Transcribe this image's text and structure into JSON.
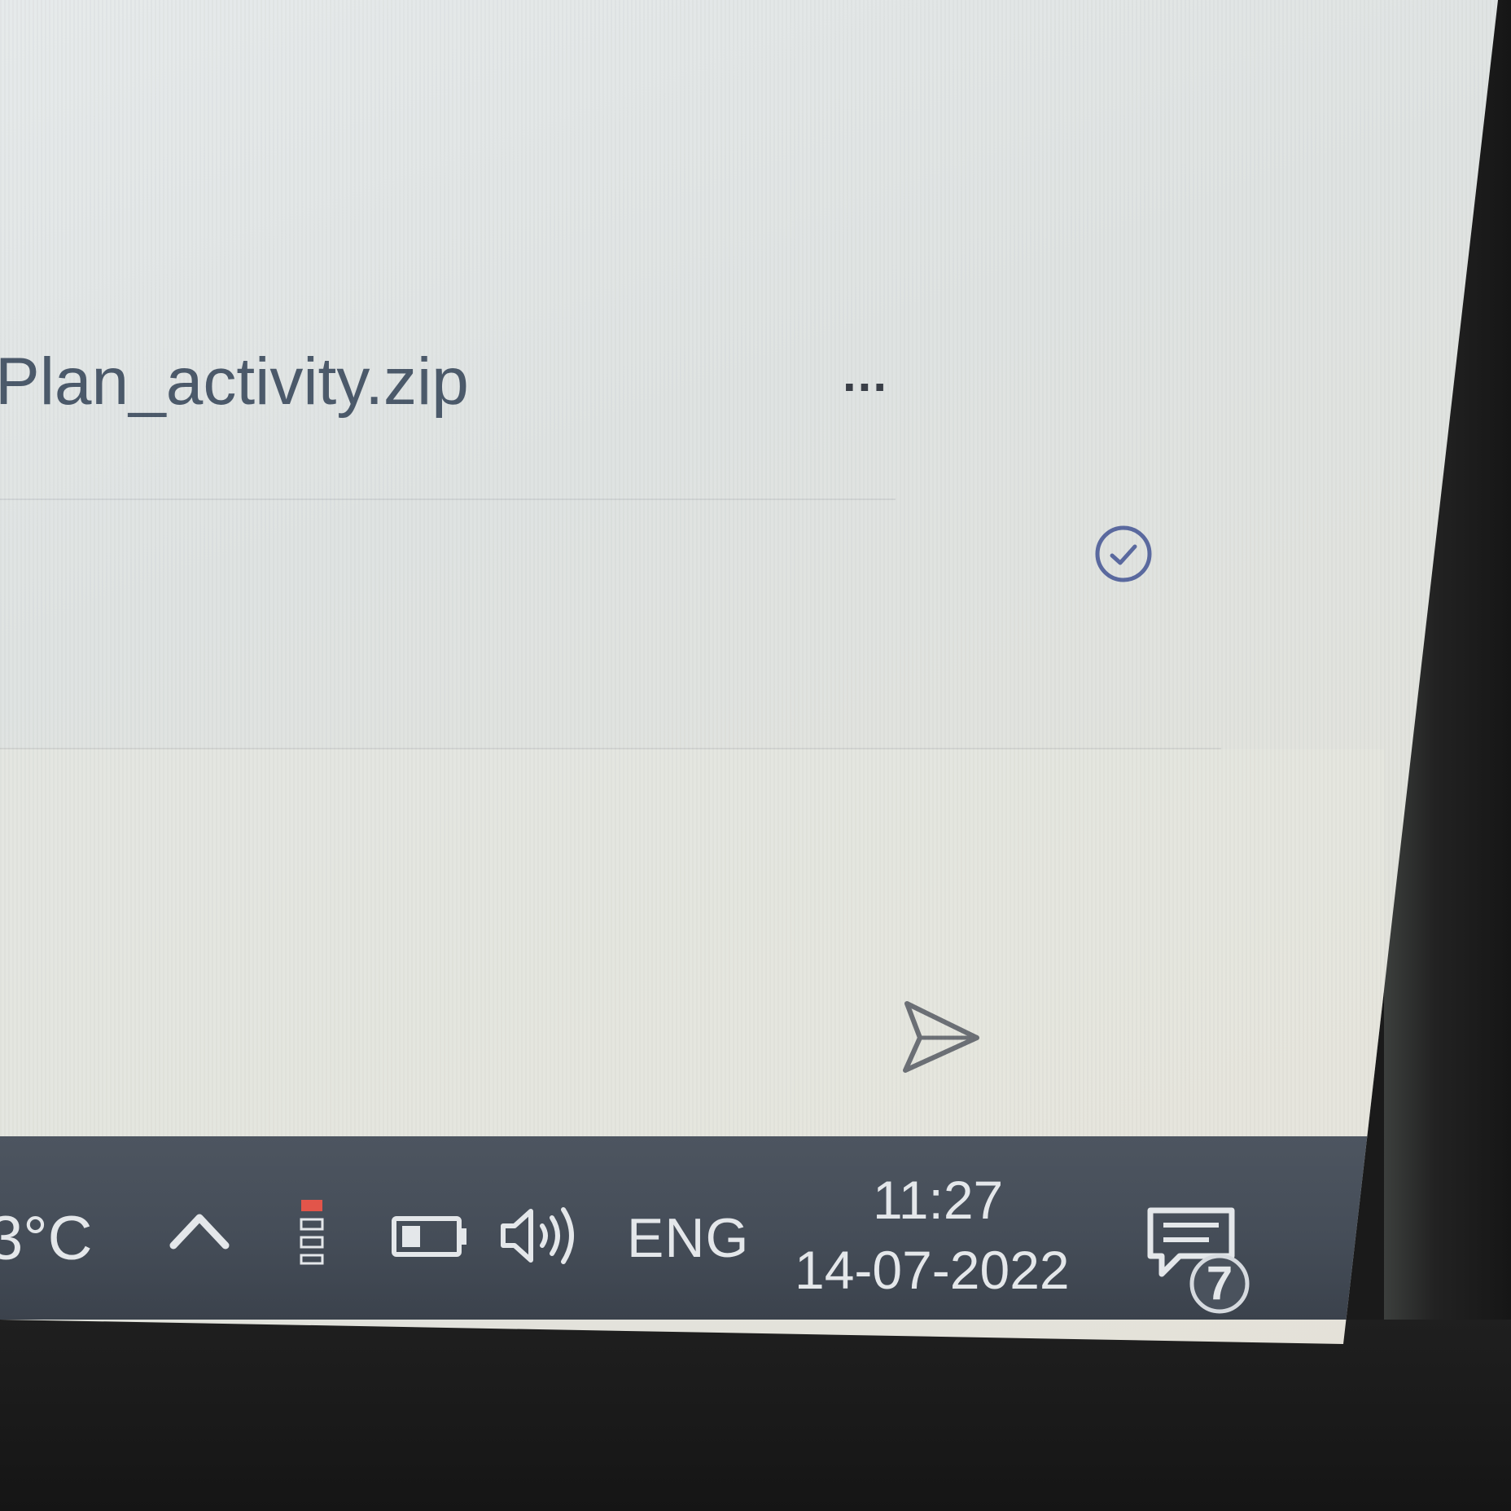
{
  "attachment": {
    "file_name": "Plan_activity.zip",
    "more_label": "..."
  },
  "icons": {
    "sent_status": "check-circle-icon",
    "send": "send-icon",
    "tray_expand": "chevron-up-icon",
    "tray_app": "app-tray-icon",
    "battery": "battery-icon",
    "volume": "volume-icon",
    "notifications": "notification-icon"
  },
  "taskbar": {
    "temperature": "3°C",
    "language": "ENG",
    "time": "11:27",
    "date": "14-07-2022",
    "notification_count": "7"
  },
  "colors": {
    "taskbar_bg": "#4a525d",
    "screen_bg": "#e3e5e2",
    "accent_icon": "#5b6aa0"
  }
}
